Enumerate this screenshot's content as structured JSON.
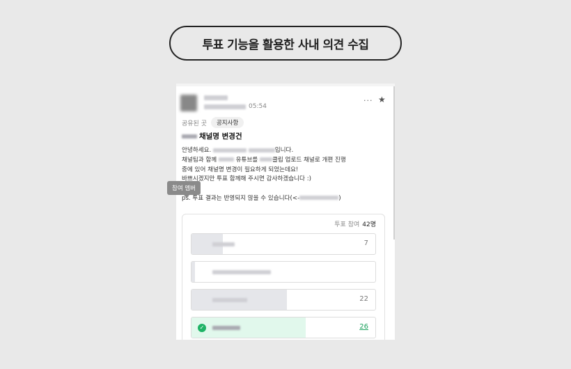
{
  "banner": {
    "title": "투표 기능을 활용한 사내 의견 수집"
  },
  "post": {
    "time": "05:54",
    "more_icon": "···",
    "star_icon": "★",
    "shared_label": "공유된 곳",
    "tag": "공지사항",
    "title": "채널명 변경건",
    "lines": {
      "l1a": "안녕하세요.",
      "l1b": "입니다.",
      "l2a": "채널팀과 함께",
      "l2b": "유튜브를",
      "l2c": "클립 업로드 채널로 개편 진행",
      "l3": "중에 있어 채널명 변경이 필요하게 되었는데요!",
      "l4": "바쁘시겠지만 투표 함께해 주시면 감사하겠습니다 :)",
      "l5a": "ps. 투표 결과는 반영되지 않을 수 있습니다(<-",
      "l5b": ")"
    }
  },
  "poll": {
    "participation_label": "투표 참여",
    "participation_count": "42명",
    "options": [
      {
        "count": "7",
        "share": 0.17,
        "selected": false
      },
      {
        "count": "",
        "share": 0.02,
        "selected": false
      },
      {
        "count": "22",
        "share": 0.52,
        "selected": false
      },
      {
        "count": "26",
        "share": 0.62,
        "selected": true
      }
    ],
    "tooltip": "참여 멤버"
  }
}
